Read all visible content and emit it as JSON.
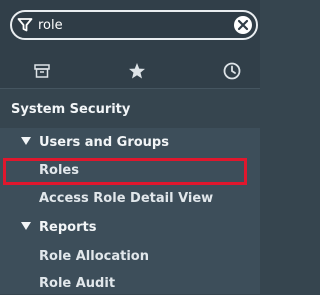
{
  "search": {
    "value": "role",
    "placeholder": ""
  },
  "tabs": [
    {
      "icon": "archive-icon"
    },
    {
      "icon": "star-icon"
    },
    {
      "icon": "clock-icon"
    }
  ],
  "nav": {
    "section_title": "System Security",
    "groups": [
      {
        "label": "Users and Groups",
        "expanded": true,
        "items": [
          {
            "label": "Roles",
            "highlighted": true
          },
          {
            "label": "Access Role Detail View"
          }
        ]
      },
      {
        "label": "Reports",
        "expanded": true,
        "items": [
          {
            "label": "Role Allocation"
          },
          {
            "label": "Role Audit"
          }
        ]
      }
    ]
  },
  "colors": {
    "highlight_border": "#e0172d",
    "panel_bg": "#3d4e5a",
    "top_bg": "#313f49"
  }
}
